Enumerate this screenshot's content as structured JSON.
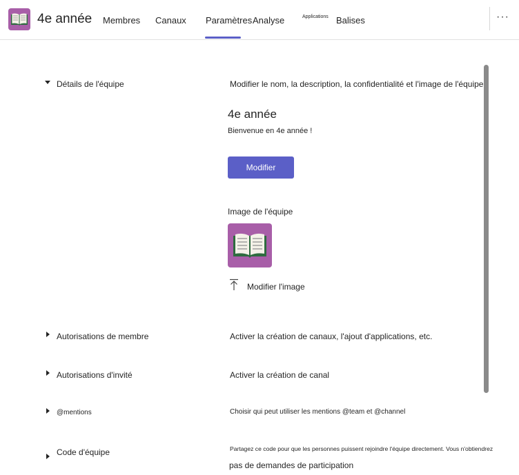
{
  "header": {
    "team_name": "4e année",
    "tabs": [
      {
        "label": "Membres"
      },
      {
        "label": "Canaux"
      },
      {
        "label": "Paramètres"
      },
      {
        "label": "Analyse"
      },
      {
        "label": "Applications"
      },
      {
        "label": "Balises"
      }
    ],
    "active_tab": "Paramètres",
    "more_label": "···"
  },
  "sections": {
    "details": {
      "label": "Détails de l'équipe",
      "description": "Modifier le nom, la description, la confidentialité et l'image de l'équipe",
      "team_title": "4e année",
      "welcome": "Bienvenue en 4e année !",
      "edit_button": "Modifier",
      "image_label": "Image de l'équipe",
      "change_image": "Modifier l'image"
    },
    "member_permissions": {
      "label": "Autorisations de membre",
      "description": "Activer la création de canaux, l'ajout d'applications, etc."
    },
    "guest_permissions": {
      "label": "Autorisations d'invité",
      "description": "Activer la création de canal"
    },
    "mentions": {
      "label": "@mentions",
      "description": "Choisir qui peut utiliser les mentions @team et @channel"
    },
    "team_code": {
      "label": "Code d'équipe",
      "description_line1": "Partagez ce code pour que les personnes puissent rejoindre l'équipe directement. Vous n'obtiendrez",
      "description_line2": "pas de demandes de participation"
    }
  },
  "colors": {
    "accent": "#5b5fc7",
    "team_avatar": "#a85ea8"
  },
  "icons": {
    "team_avatar": "book-icon",
    "upload": "upload-icon",
    "more": "more-options-icon"
  }
}
